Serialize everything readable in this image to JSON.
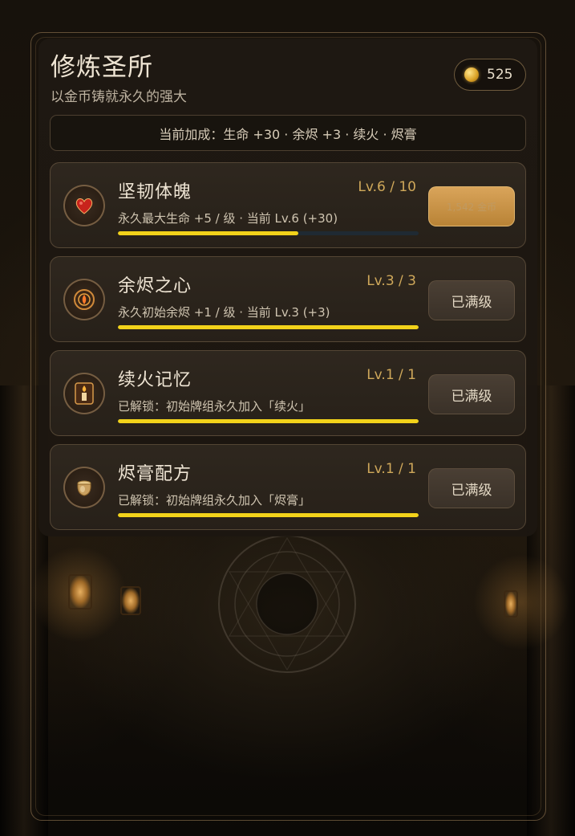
{
  "header": {
    "title": "修炼圣所",
    "subtitle": "以金币铸就永久的强大",
    "coins": "525"
  },
  "bonus_summary": "当前加成：生命 +30 · 余烬 +3 · 续火 · 烬膏",
  "upgrades": [
    {
      "name": "坚韧体魄",
      "level": "Lv.6 / 10",
      "desc": "永久最大生命 +5 / 级 · 当前 Lv.6 (+30)",
      "progress": 0.6,
      "button": "1,542 金币",
      "icon": "heart-potion-icon"
    },
    {
      "name": "余烬之心",
      "level": "Lv.3 / 3",
      "desc": "永久初始余烬 +1 / 级 · 当前 Lv.3 (+3)",
      "progress": 1.0,
      "button": "已满级",
      "icon": "ember-sigil-icon"
    },
    {
      "name": "续火记忆",
      "level": "Lv.1 / 1",
      "desc": "已解锁：初始牌组永久加入「续火」",
      "progress": 1.0,
      "button": "已满级",
      "icon": "candle-card-icon"
    },
    {
      "name": "烬膏配方",
      "level": "Lv.1 / 1",
      "desc": "已解锁：初始牌组永久加入「烬膏」",
      "progress": 1.0,
      "button": "已满级",
      "icon": "salve-jar-icon"
    }
  ],
  "colors": {
    "progress": "#f2d21a",
    "level_text": "#cfa85a",
    "upgrade_button": "#d9a45a"
  }
}
